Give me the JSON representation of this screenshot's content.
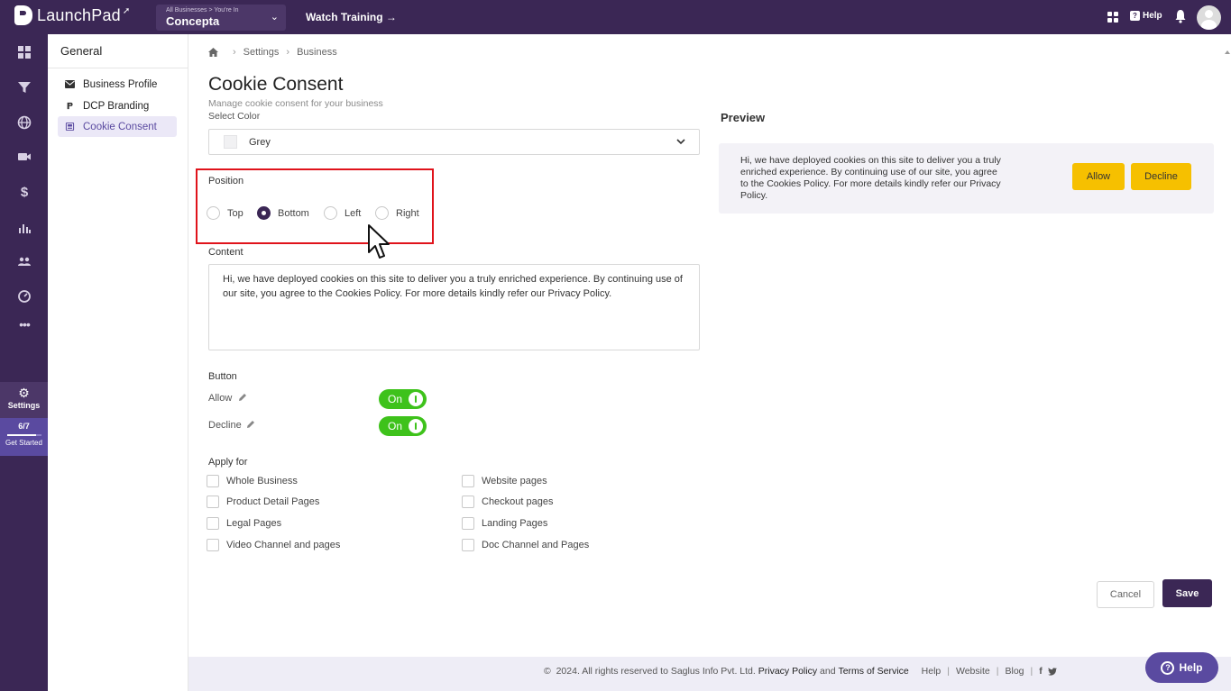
{
  "topbar": {
    "logo_text": "LaunchPad",
    "business_caption": "All Businesses > You're In",
    "business_name": "Concepta",
    "watch_training": "Watch Training →",
    "help_label": "Help"
  },
  "rail": {
    "settings_label": "Settings",
    "progress": "6/7",
    "get_started": "Get Started"
  },
  "subnav": {
    "title": "General",
    "items": [
      {
        "label": "Business Profile",
        "icon": "envelope-icon"
      },
      {
        "label": "DCP Branding",
        "icon": "dcp-logo-icon"
      },
      {
        "label": "Cookie Consent",
        "icon": "cookie-icon"
      }
    ]
  },
  "breadcrumb": {
    "items": [
      "Settings",
      "Business"
    ]
  },
  "page": {
    "title": "Cookie Consent",
    "subtitle": "Manage cookie consent for your business"
  },
  "color": {
    "label": "Select Color",
    "value": "Grey",
    "swatch": "#f1f1f3"
  },
  "position": {
    "label": "Position",
    "options": [
      "Top",
      "Bottom",
      "Left",
      "Right"
    ],
    "selected": "Bottom"
  },
  "content": {
    "label": "Content",
    "text": "Hi, we have deployed cookies on this site to deliver you a truly enriched experience. By continuing use of our site, you agree to the Cookies Policy. For more details kindly refer our Privacy Policy."
  },
  "button": {
    "label": "Button",
    "allow_label": "Allow",
    "decline_label": "Decline",
    "allow_state": "On",
    "decline_state": "On"
  },
  "apply_for": {
    "label": "Apply for",
    "left": [
      "Whole Business",
      "Product Detail Pages",
      "Legal Pages",
      "Video Channel and pages"
    ],
    "right": [
      "Website pages",
      "Checkout pages",
      "Landing Pages",
      "Doc Channel and Pages"
    ]
  },
  "preview": {
    "title": "Preview",
    "text": "Hi, we have deployed cookies on this site to deliver you a truly enriched experience. By continuing use of our site, you agree to the Cookies Policy. For more details kindly refer our Privacy Policy.",
    "allow": "Allow",
    "decline": "Decline",
    "button_color": "#f6c000"
  },
  "actions": {
    "cancel": "Cancel",
    "save": "Save"
  },
  "footer": {
    "copyright": "2024. All rights reserved to Saglus Info Pvt. Ltd.",
    "privacy": "Privacy Policy",
    "and": "and",
    "terms": "Terms of Service",
    "help": "Help",
    "website": "Website",
    "blog": "Blog"
  },
  "help_fab": "Help",
  "colors": {
    "brand": "#3b2755",
    "accent": "#5a4aa0",
    "toggle_on": "#3ec21b",
    "highlight": "#e0131b"
  }
}
